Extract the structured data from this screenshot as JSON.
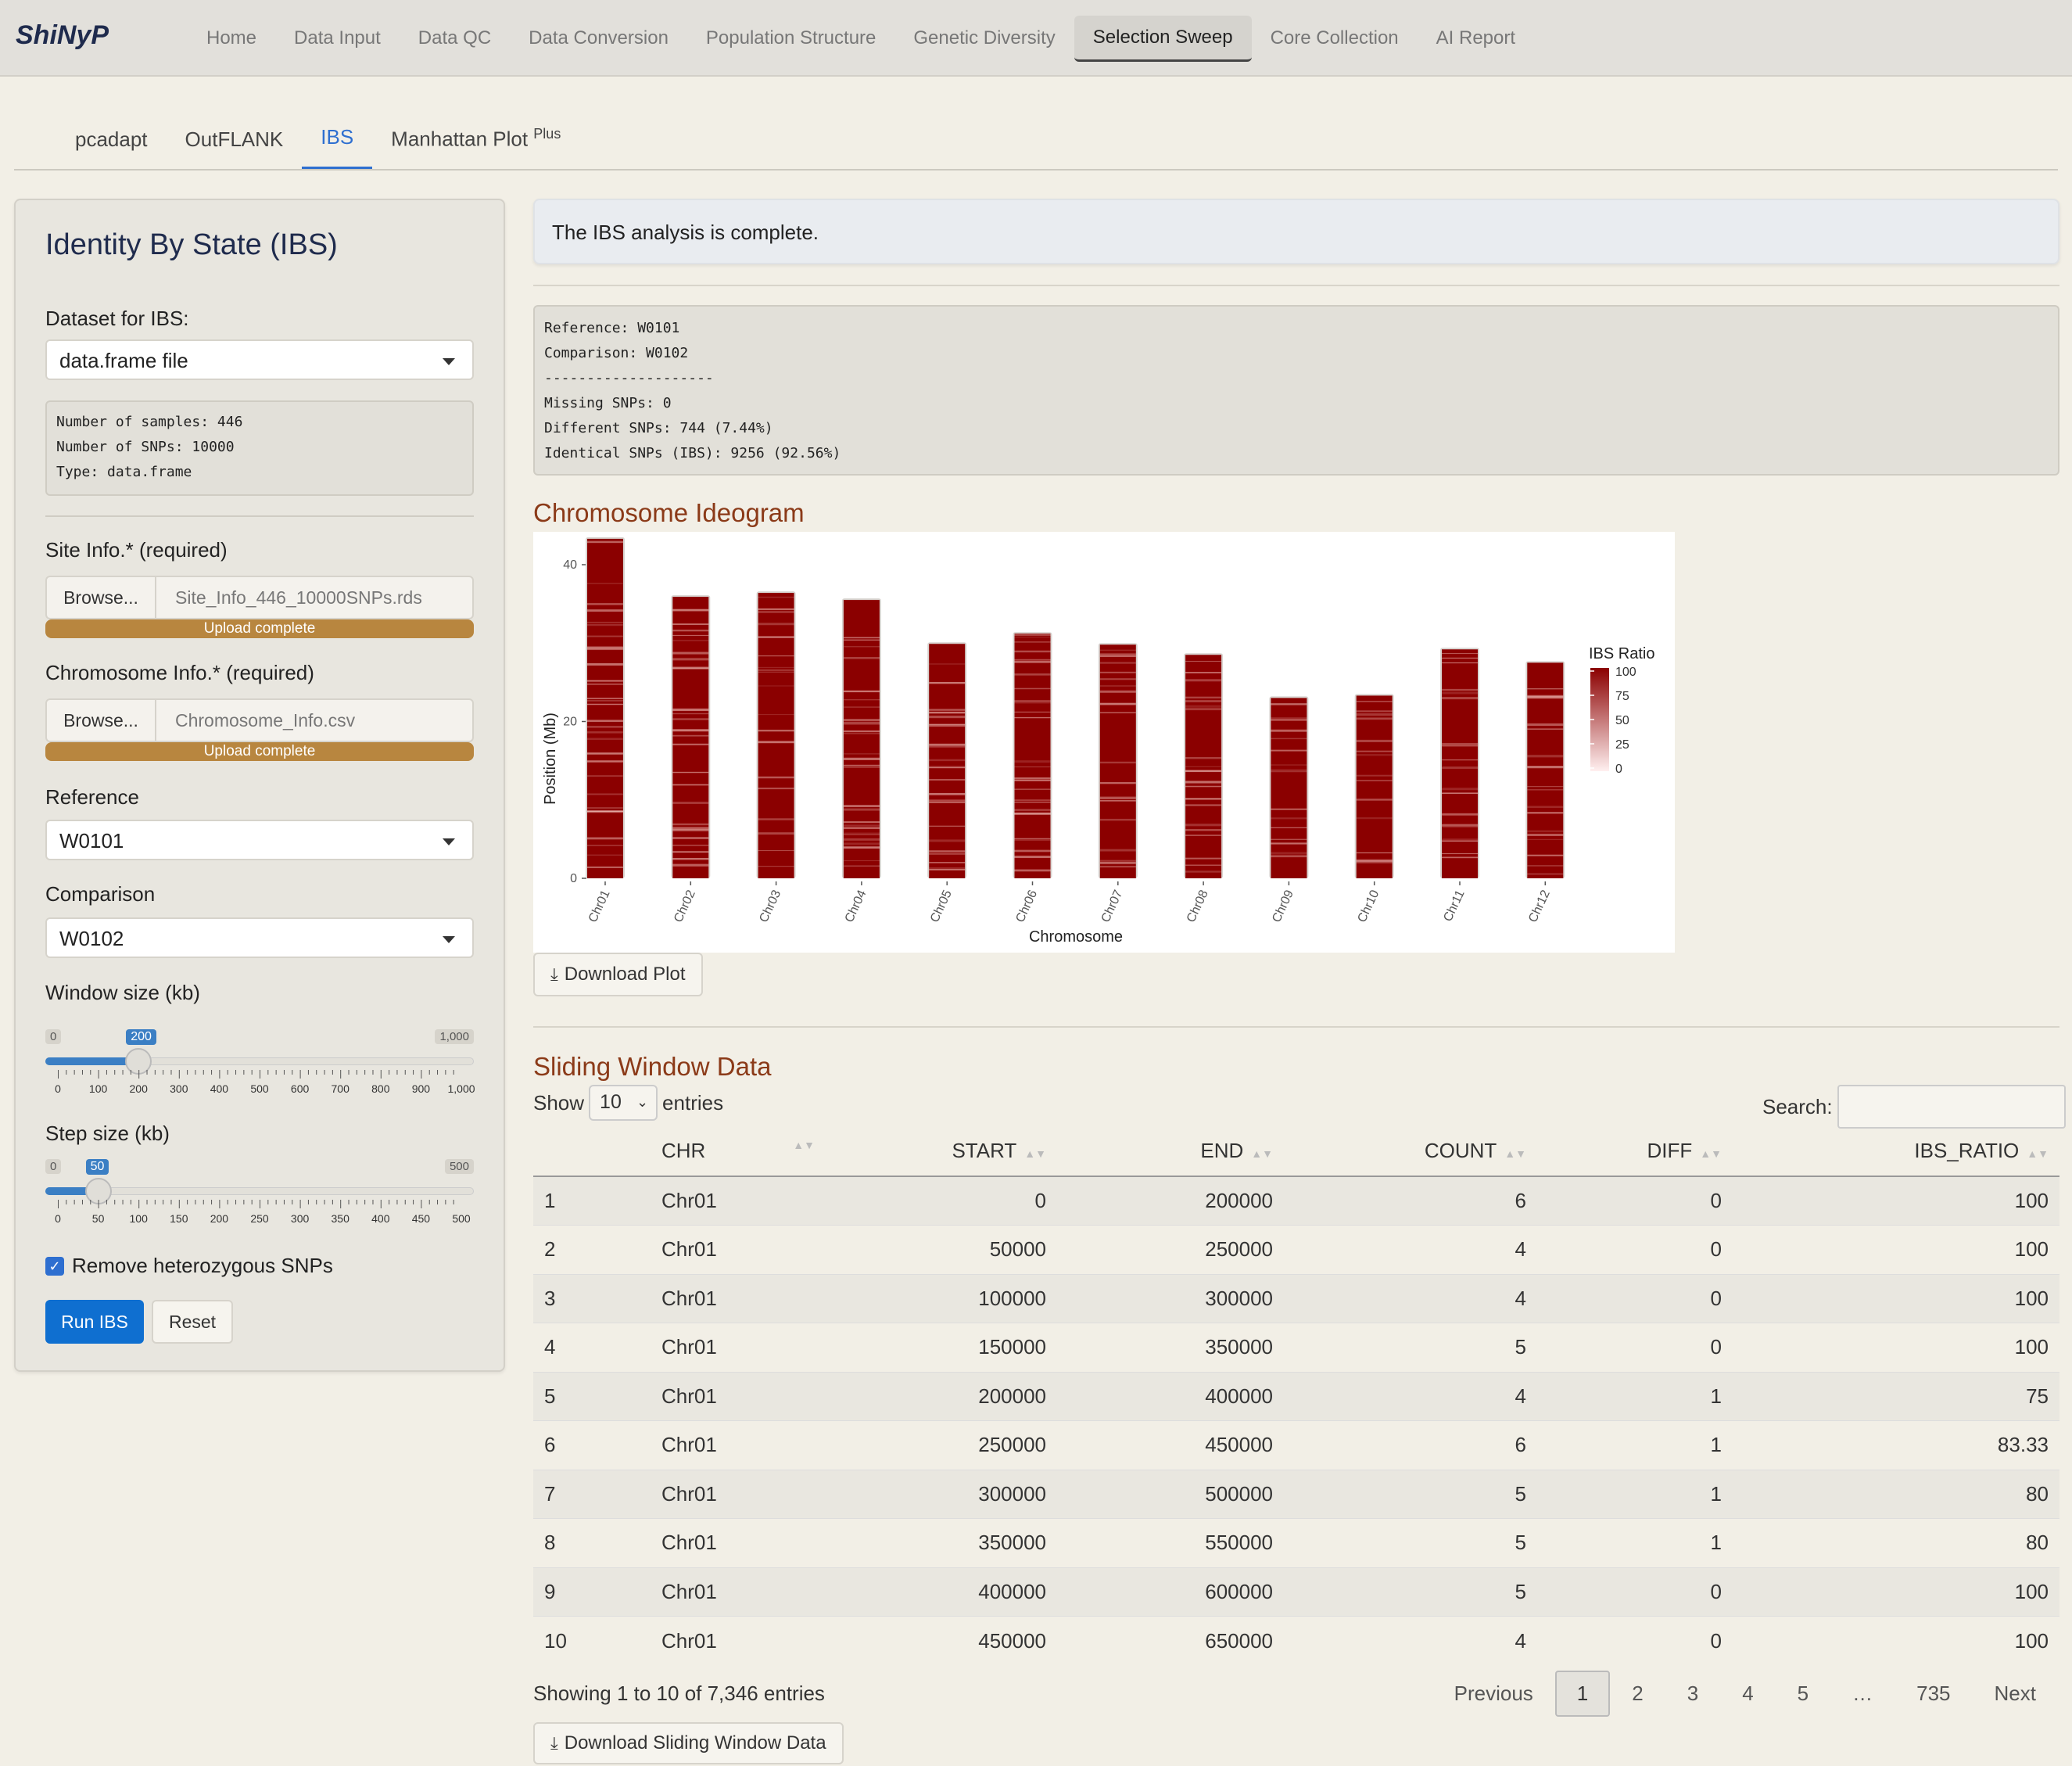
{
  "app": {
    "brand": "ShiNyP"
  },
  "nav": {
    "items": [
      "Home",
      "Data Input",
      "Data QC",
      "Data Conversion",
      "Population Structure",
      "Genetic Diversity",
      "Selection Sweep",
      "Core Collection",
      "AI Report"
    ],
    "active": "Selection Sweep"
  },
  "subtabs": {
    "pcadapt": "pcadapt",
    "outflank": "OutFLANK",
    "ibs": "IBS",
    "manhattan": "Manhattan Plot",
    "manhattan_sup": "Plus",
    "active": "IBS"
  },
  "sidebar": {
    "title": "Identity By State (IBS)",
    "dataset_label": "Dataset for IBS:",
    "dataset_value": "data.frame file",
    "dataset_info": "Number of samples: 446\nNumber of SNPs: 10000\nType: data.frame",
    "site_label": "Site Info.* (required)",
    "site_browse": "Browse...",
    "site_file": "Site_Info_446_10000SNPs.rds",
    "site_progress": "Upload complete",
    "site_progress_fraction": 1.0,
    "chrom_label": "Chromosome Info.* (required)",
    "chrom_browse": "Browse...",
    "chrom_file": "Chromosome_Info.csv",
    "chrom_progress": "Upload complete",
    "chrom_progress_fraction": 1.0,
    "reference_label": "Reference",
    "reference_value": "W0101",
    "comparison_label": "Comparison",
    "comparison_value": "W0102",
    "window": {
      "label": "Window size (kb)",
      "min": 0,
      "max": 1000,
      "value": 200,
      "min_label": "0",
      "max_label": "1,000",
      "value_label": "200",
      "tick_labels": [
        "0",
        "100",
        "200",
        "300",
        "400",
        "500",
        "600",
        "700",
        "800",
        "900",
        "1,000"
      ]
    },
    "step": {
      "label": "Step size (kb)",
      "min": 0,
      "max": 500,
      "value": 50,
      "min_label": "0",
      "max_label": "500",
      "value_label": "50",
      "tick_labels": [
        "0",
        "50",
        "100",
        "150",
        "200",
        "250",
        "300",
        "350",
        "400",
        "450",
        "500"
      ]
    },
    "remove_het_label": "Remove heterozygous SNPs",
    "remove_het_checked": true,
    "run_label": "Run IBS",
    "reset_label": "Reset"
  },
  "main": {
    "alert": "The IBS analysis is complete.",
    "summary": "Reference: W0101\nComparison: W0102\n--------------------\nMissing SNPs: 0\nDifferent SNPs: 744 (7.44%)\nIdentical SNPs (IBS): 9256 (92.56%)",
    "ideogram_title": "Chromosome Ideogram",
    "download_plot": "Download Plot",
    "sliding_title": "Sliding Window Data",
    "show_label": "Show",
    "show_value": "10",
    "entries_label": "entries",
    "search_label": "Search:",
    "columns": [
      "",
      "CHR",
      "START",
      "END",
      "COUNT",
      "DIFF",
      "IBS_RATIO"
    ],
    "rows": [
      [
        "1",
        "Chr01",
        "0",
        "200000",
        "6",
        "0",
        "100"
      ],
      [
        "2",
        "Chr01",
        "50000",
        "250000",
        "4",
        "0",
        "100"
      ],
      [
        "3",
        "Chr01",
        "100000",
        "300000",
        "4",
        "0",
        "100"
      ],
      [
        "4",
        "Chr01",
        "150000",
        "350000",
        "5",
        "0",
        "100"
      ],
      [
        "5",
        "Chr01",
        "200000",
        "400000",
        "4",
        "1",
        "75"
      ],
      [
        "6",
        "Chr01",
        "250000",
        "450000",
        "6",
        "1",
        "83.33"
      ],
      [
        "7",
        "Chr01",
        "300000",
        "500000",
        "5",
        "1",
        "80"
      ],
      [
        "8",
        "Chr01",
        "350000",
        "550000",
        "5",
        "1",
        "80"
      ],
      [
        "9",
        "Chr01",
        "400000",
        "600000",
        "5",
        "0",
        "100"
      ],
      [
        "10",
        "Chr01",
        "450000",
        "650000",
        "4",
        "0",
        "100"
      ]
    ],
    "info": "Showing 1 to 10 of 7,346 entries",
    "pager": {
      "previous": "Previous",
      "pages": [
        "1",
        "2",
        "3",
        "4",
        "5",
        "…",
        "735"
      ],
      "current": "1",
      "next": "Next"
    },
    "download_data": "Download Sliding Window Data"
  },
  "chart_data": {
    "type": "heatmap",
    "xlabel": "Chromosome",
    "ylabel": "Position (Mb)",
    "categories": [
      "Chr01",
      "Chr02",
      "Chr03",
      "Chr04",
      "Chr05",
      "Chr06",
      "Chr07",
      "Chr08",
      "Chr09",
      "Chr10",
      "Chr11",
      "Chr12"
    ],
    "lengths_mb": [
      43.3,
      35.9,
      36.4,
      35.5,
      29.9,
      31.2,
      29.8,
      28.5,
      23.0,
      23.3,
      29.2,
      27.5
    ],
    "y_ticks": [
      0,
      20,
      40
    ],
    "ylim": [
      0,
      43.3
    ],
    "legend": {
      "title": "IBS Ratio",
      "ticks": [
        100,
        75,
        50,
        25,
        0
      ],
      "high_color": "#8b0000",
      "low_color": "#fff0f0",
      "placement": "right"
    }
  },
  "colors": {
    "accent": "#2e6fd0",
    "primary_button": "#0f6fd0",
    "section_title": "#8b3a18",
    "upload_bar": "#b8863f",
    "ideogram_base": "#8b0000"
  }
}
